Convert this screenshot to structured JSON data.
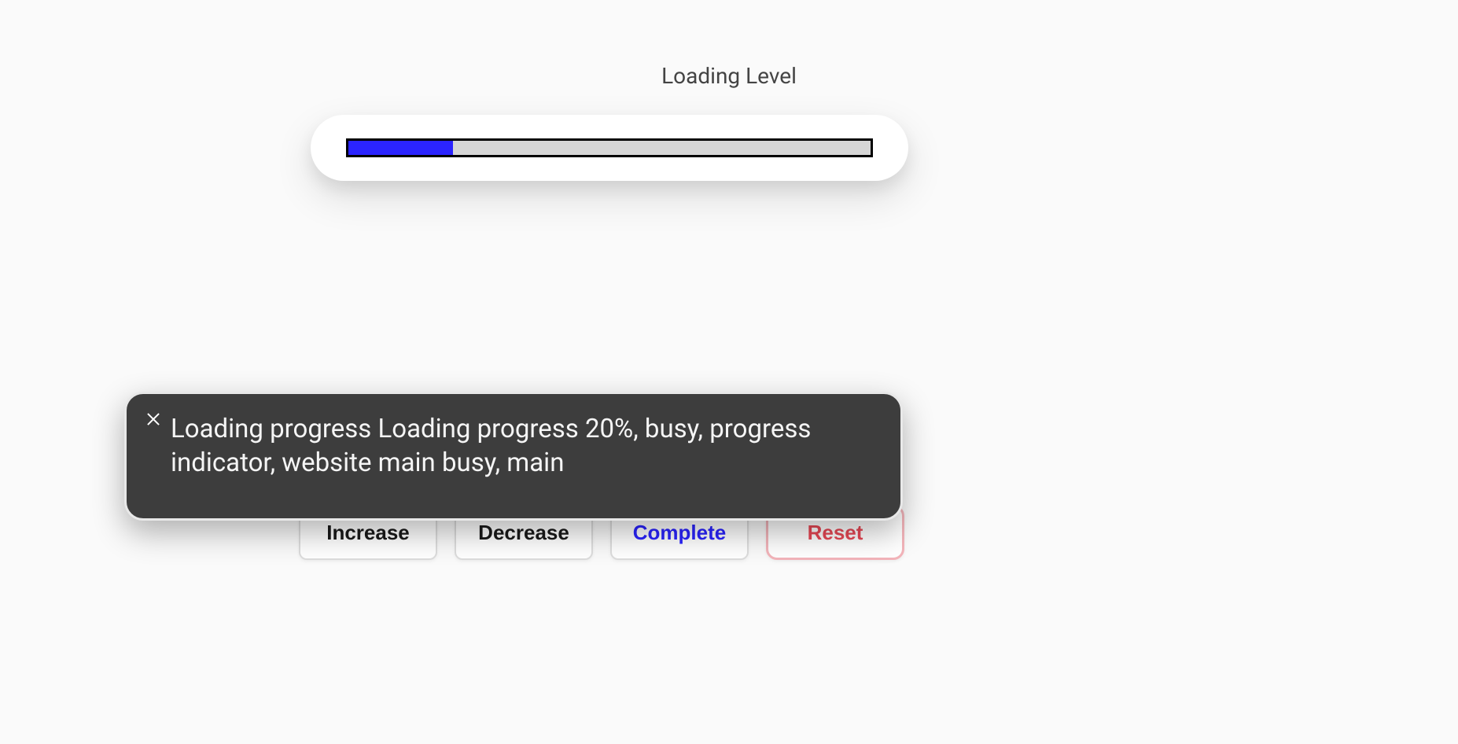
{
  "title": "Loading Level",
  "progress": {
    "percent": 20
  },
  "buttons": {
    "increase": "Increase",
    "decrease": "Decrease",
    "complete": "Complete",
    "reset": "Reset"
  },
  "popover": {
    "text": "Loading progress Loading progress 20%, busy, progress indicator, website main busy, main"
  }
}
